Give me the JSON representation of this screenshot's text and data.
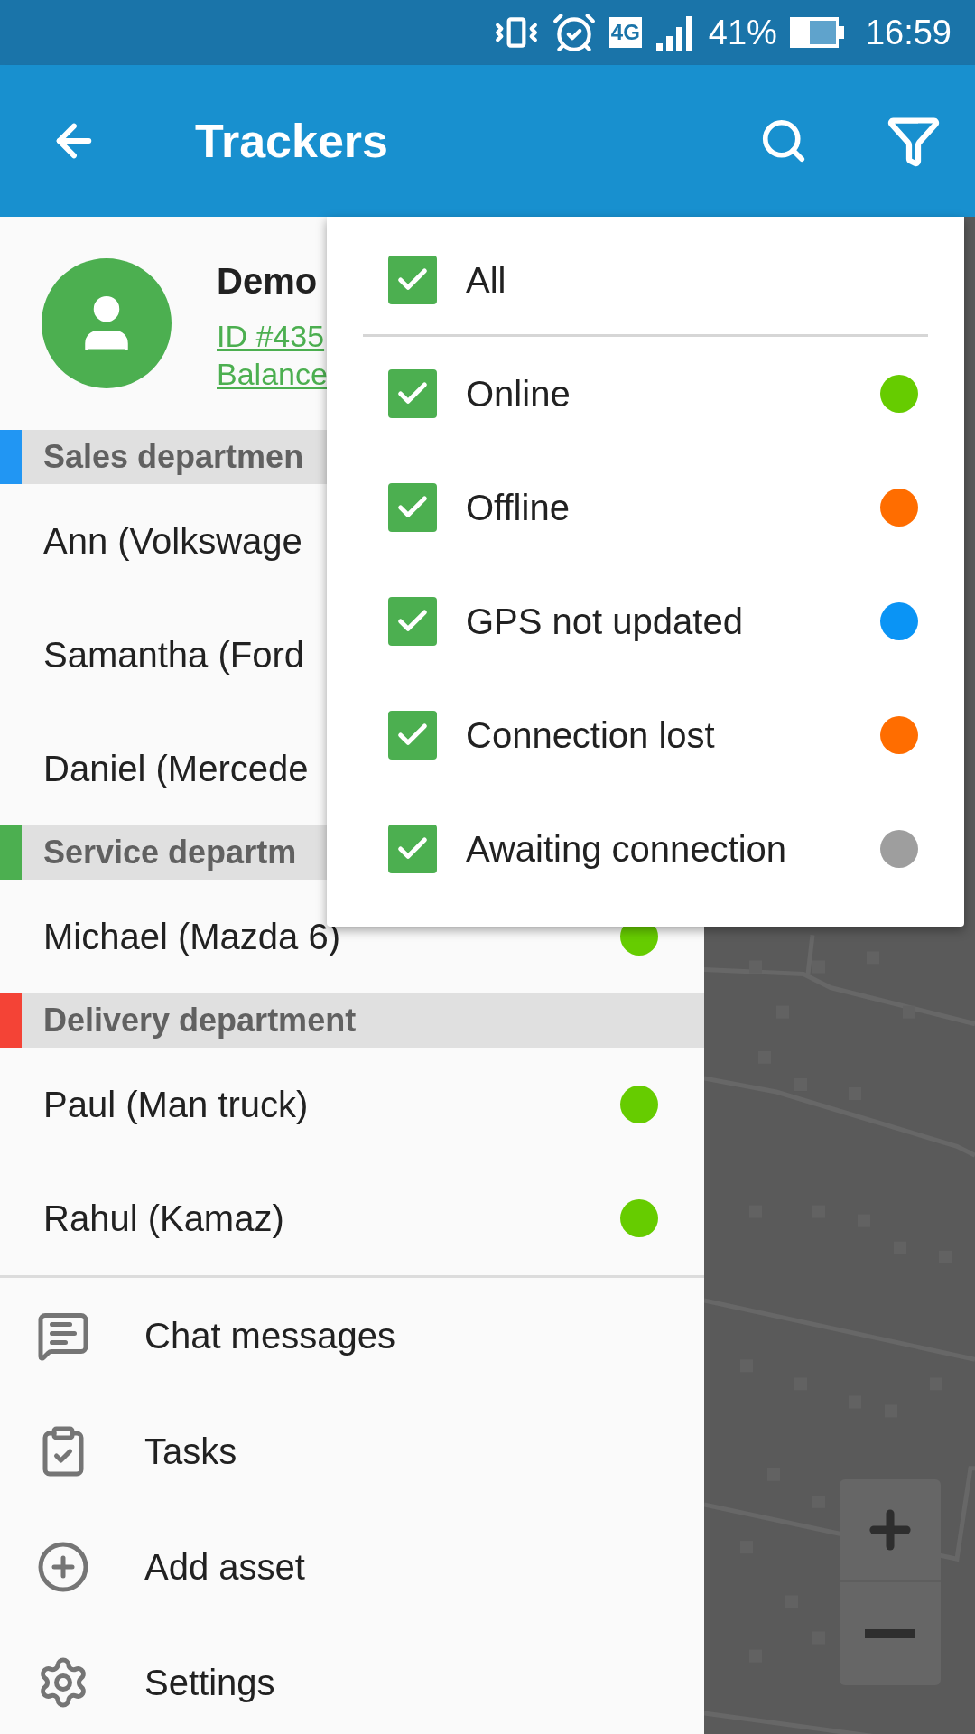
{
  "status_bar": {
    "network": "4G",
    "battery": "41%",
    "time": "16:59"
  },
  "app_bar": {
    "title": "Trackers"
  },
  "profile": {
    "name": "Demo",
    "id_link": "ID #435",
    "balance_link": "Balance"
  },
  "groups": [
    {
      "title": "Sales departmen",
      "color": "#2196f3",
      "trackers": [
        {
          "name": "Ann (Volkswage"
        },
        {
          "name": "Samantha (Ford"
        },
        {
          "name": "Daniel (Mercede"
        }
      ]
    },
    {
      "title": "Service departm",
      "color": "#4caf50",
      "trackers": [
        {
          "name": "Michael (Mazda 6)",
          "color": "#66cc00"
        }
      ]
    },
    {
      "title": "Delivery department",
      "color": "#f44336",
      "trackers": [
        {
          "name": "Paul (Man truck)",
          "color": "#66cc00"
        },
        {
          "name": "Rahul (Kamaz)",
          "color": "#66cc00"
        }
      ]
    }
  ],
  "menu": [
    {
      "kind": "chat",
      "label": "Chat messages"
    },
    {
      "kind": "tasks",
      "label": "Tasks"
    },
    {
      "kind": "add",
      "label": "Add asset"
    },
    {
      "kind": "settings",
      "label": "Settings"
    }
  ],
  "filter_menu": {
    "all": {
      "label": "All",
      "checked": true
    },
    "statuses": [
      {
        "label": "Online",
        "checked": true,
        "color": "#66cc00"
      },
      {
        "label": "Offline",
        "checked": true,
        "color": "#ff6d00"
      },
      {
        "label": "GPS not updated",
        "checked": true,
        "color": "#0a94f5"
      },
      {
        "label": "Connection lost",
        "checked": true,
        "color": "#ff6d00"
      },
      {
        "label": "Awaiting connection",
        "checked": true,
        "color": "#9e9e9e"
      }
    ]
  }
}
